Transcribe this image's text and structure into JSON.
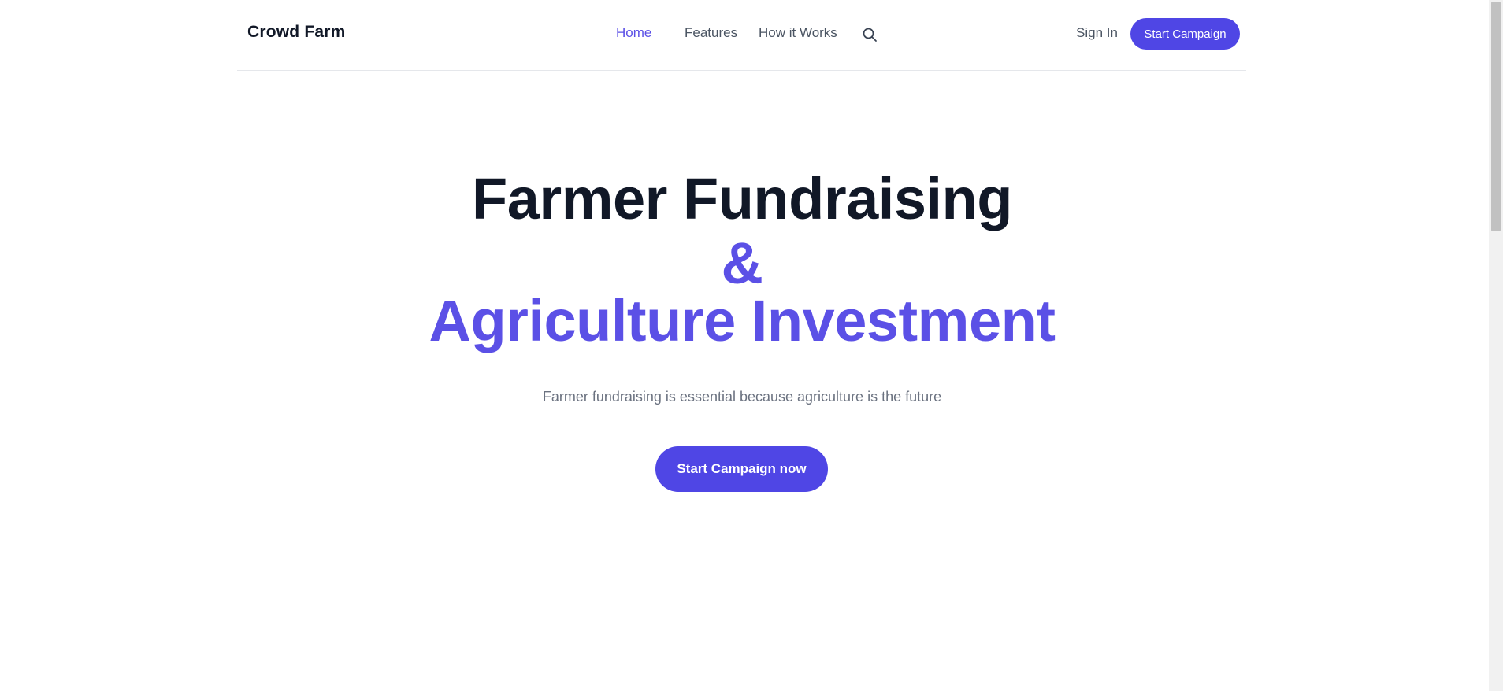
{
  "header": {
    "logo": "Crowd Farm",
    "nav": {
      "home": "Home",
      "features": "Features",
      "how_it_works": "How it Works"
    },
    "search_icon": "search-icon",
    "sign_in": "Sign In",
    "start_campaign": "Start Campaign"
  },
  "hero": {
    "title_line1": "Farmer Fundraising",
    "title_line2": "&",
    "title_line3": "Agriculture Investment",
    "subtitle": "Farmer fundraising is essential because agriculture is the future",
    "cta": "Start Campaign now"
  },
  "colors": {
    "accent": "#4f46e5",
    "accent_text": "#5b50e6",
    "heading": "#111827",
    "muted": "#6b7280"
  }
}
